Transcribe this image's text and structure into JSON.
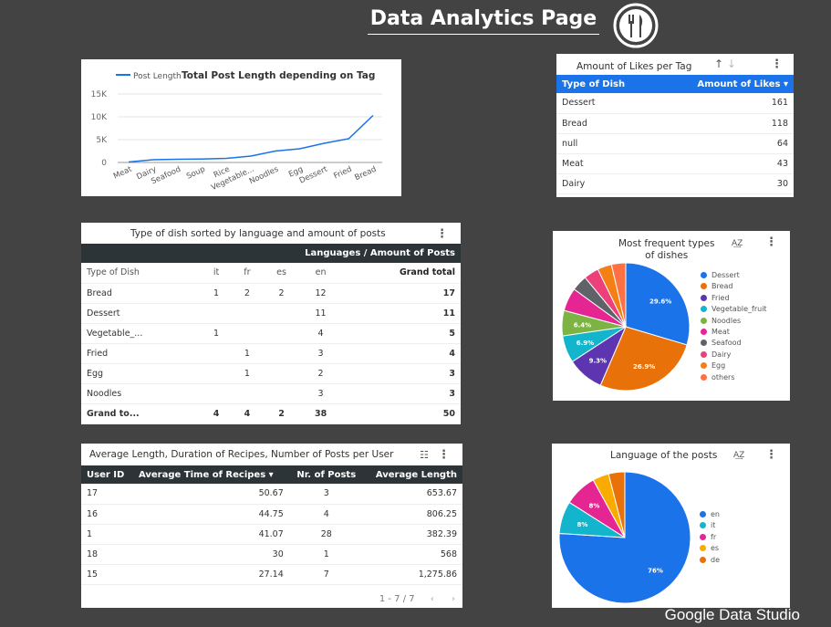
{
  "page": {
    "title": "Data Analytics Page",
    "footer": "Google Data Studio"
  },
  "colors": {
    "background": "#434343",
    "blue": "#1a73e8",
    "dark_header": "#2c3437"
  },
  "line_chart": {
    "title": "Total Post Length depending on Tag",
    "legend": "Post Length",
    "yticks": [
      "15K",
      "10K",
      "5K",
      "0"
    ]
  },
  "likes_table": {
    "title": "Amount of Likes per Tag",
    "headers": [
      "Type of Dish",
      "Amount of Likes"
    ],
    "rows": [
      [
        "Dessert",
        "161"
      ],
      [
        "Bread",
        "118"
      ],
      [
        "null",
        "64"
      ],
      [
        "Meat",
        "43"
      ],
      [
        "Dairy",
        "30"
      ]
    ]
  },
  "pivot_table": {
    "title": "Type of dish sorted by language and amount of posts",
    "group_header": "Languages / Amount of Posts",
    "headers": [
      "Type of Dish",
      "it",
      "fr",
      "es",
      "en",
      "Grand total"
    ],
    "rows": [
      [
        "Bread",
        "1",
        "2",
        "2",
        "12",
        "17"
      ],
      [
        "Dessert",
        "",
        "",
        "",
        "11",
        "11"
      ],
      [
        "Vegetable_...",
        "1",
        "",
        "",
        "4",
        "5"
      ],
      [
        "Fried",
        "",
        "1",
        "",
        "3",
        "4"
      ],
      [
        "Egg",
        "",
        "1",
        "",
        "2",
        "3"
      ],
      [
        "Noodles",
        "",
        "",
        "",
        "3",
        "3"
      ]
    ],
    "total_row": [
      "Grand to...",
      "4",
      "4",
      "2",
      "38",
      "50"
    ]
  },
  "avg_table": {
    "title": "Average Length, Duration of Recipes, Number of Posts per User",
    "headers": [
      "User ID",
      "Average Time of Recipes",
      "Nr. of Posts",
      "Average Length"
    ],
    "rows": [
      [
        "17",
        "50.67",
        "3",
        "653.67"
      ],
      [
        "16",
        "44.75",
        "4",
        "806.25"
      ],
      [
        "1",
        "41.07",
        "28",
        "382.39"
      ],
      [
        "18",
        "30",
        "1",
        "568"
      ],
      [
        "15",
        "27.14",
        "7",
        "1,275.86"
      ]
    ],
    "pagination": "1 - 7 / 7"
  },
  "dish_pie": {
    "title_line1": "Most frequent types",
    "title_line2": "of dishes",
    "labels": [
      "29.6%",
      "26.9%",
      "9.3%",
      "6.9%",
      "6.4%"
    ]
  },
  "lang_pie": {
    "title": "Language of the posts",
    "labels": [
      "76%",
      "8%",
      "8%"
    ]
  },
  "chart_data": [
    {
      "type": "line",
      "title": "Total Post Length depending on Tag",
      "categories": [
        "Meat",
        "Dairy",
        "Seafood",
        "Soup",
        "Rice",
        "Vegetable...",
        "Noodles",
        "Egg",
        "Dessert",
        "Fried",
        "Bread"
      ],
      "series": [
        {
          "name": "Post Length",
          "values": [
            100,
            600,
            700,
            750,
            900,
            1400,
            2500,
            3000,
            4200,
            5200,
            10300
          ]
        }
      ],
      "ylim": [
        0,
        15000
      ],
      "grid": true,
      "legend": "top-left"
    },
    {
      "type": "pie",
      "title": "Most frequent types of dishes",
      "categories": [
        "Dessert",
        "Bread",
        "Fried",
        "Vegetable_fruit",
        "Noodles",
        "Meat",
        "Seafood",
        "Dairy",
        "Egg",
        "others"
      ],
      "values": [
        29.6,
        26.9,
        9.3,
        6.9,
        6.4,
        5.9,
        4.0,
        3.8,
        3.6,
        3.6
      ],
      "colors": [
        "#1a73e8",
        "#e8710a",
        "#5e35b1",
        "#12b5cb",
        "#7cb342",
        "#e52592",
        "#5f6368",
        "#ec407a",
        "#f57f17",
        "#ff7043"
      ],
      "legend": "right"
    },
    {
      "type": "pie",
      "title": "Language of the posts",
      "categories": [
        "en",
        "it",
        "fr",
        "es",
        "de"
      ],
      "values": [
        76,
        8,
        8,
        4,
        4
      ],
      "colors": [
        "#1a73e8",
        "#12b5cb",
        "#e52592",
        "#f9ab00",
        "#e8710a"
      ],
      "legend": "right"
    }
  ]
}
